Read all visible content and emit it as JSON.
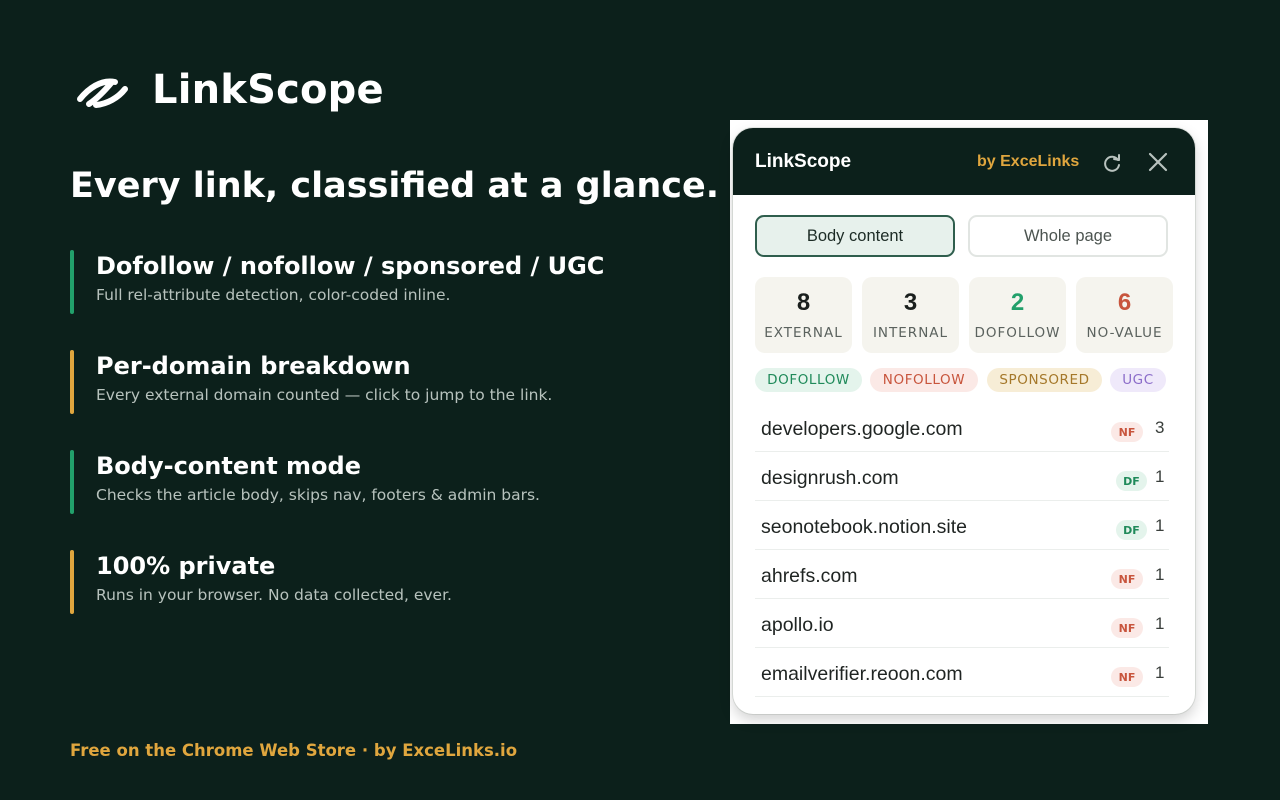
{
  "brand": {
    "name": "LinkScope",
    "logo_icon": "link-swoosh-icon"
  },
  "headline": "Every link, classified at a glance.",
  "features": [
    {
      "title": "Dofollow / nofollow / sponsored / UGC",
      "desc": "Full rel-attribute detection, color-coded inline.",
      "accent": "#22a06b"
    },
    {
      "title": "Per-domain breakdown",
      "desc": "Every external domain counted — click to jump to the link.",
      "accent": "#e0a63e"
    },
    {
      "title": "Body-content mode",
      "desc": "Checks the article body, skips nav, footers & admin bars.",
      "accent": "#22a06b"
    },
    {
      "title": "100% private",
      "desc": "Runs in your browser. No data collected, ever.",
      "accent": "#e0a63e"
    }
  ],
  "footer": "Free on the Chrome Web Store · by ExceLinks.io",
  "popup": {
    "title": "LinkScope",
    "by": "by ExceLinks",
    "refresh_icon": "refresh-icon",
    "close_icon": "close-icon",
    "tabs": [
      {
        "label": "Body content",
        "active": true
      },
      {
        "label": "Whole page",
        "active": false
      }
    ],
    "stats": [
      {
        "value": "8",
        "label": "EXTERNAL",
        "color": "#1a1f1d"
      },
      {
        "value": "3",
        "label": "INTERNAL",
        "color": "#1a1f1d"
      },
      {
        "value": "2",
        "label": "DOFOLLOW",
        "color": "#22a06b"
      },
      {
        "value": "6",
        "label": "NO-VALUE",
        "color": "#c8553d"
      }
    ],
    "pills": [
      {
        "label": "DOFOLLOW",
        "color": "#1f8a5a",
        "bg": "#e4f4ec"
      },
      {
        "label": "NOFOLLOW",
        "color": "#c8553d",
        "bg": "#fbe9e6"
      },
      {
        "label": "SPONSORED",
        "color": "#a5782a",
        "bg": "#f7edd6"
      },
      {
        "label": "UGC",
        "color": "#8b6cc9",
        "bg": "#efe9fa"
      }
    ],
    "rows": [
      {
        "domain": "developers.google.com",
        "badge": "NF",
        "count": "3"
      },
      {
        "domain": "designrush.com",
        "badge": "DF",
        "count": "1"
      },
      {
        "domain": "seonotebook.notion.site",
        "badge": "DF",
        "count": "1"
      },
      {
        "domain": "ahrefs.com",
        "badge": "NF",
        "count": "1"
      },
      {
        "domain": "apollo.io",
        "badge": "NF",
        "count": "1"
      },
      {
        "domain": "emailverifier.reoon.com",
        "badge": "NF",
        "count": "1"
      }
    ]
  }
}
